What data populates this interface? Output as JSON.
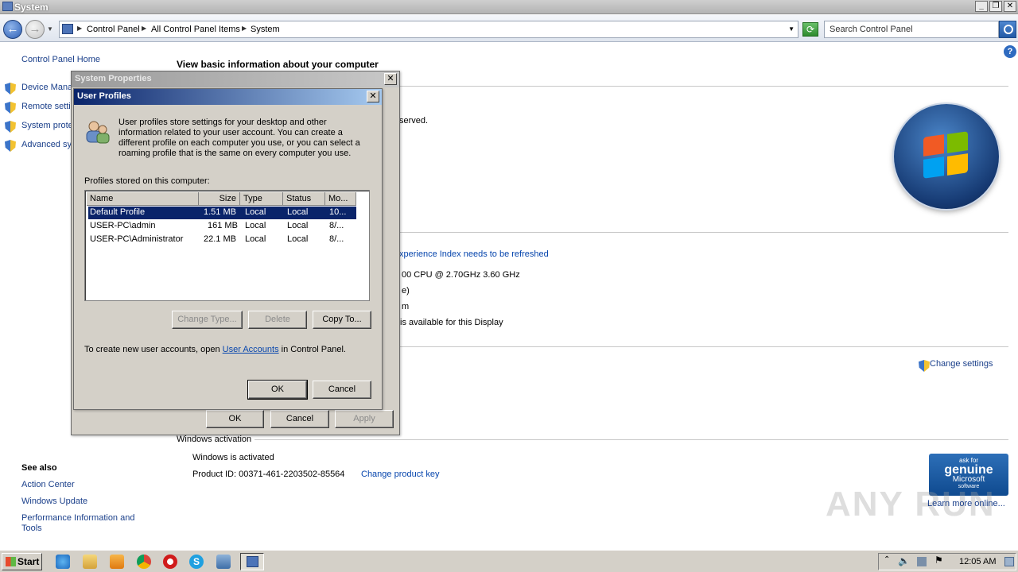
{
  "window": {
    "title": "System"
  },
  "address": {
    "crumbs": [
      "Control Panel",
      "All Control Panel Items",
      "System"
    ],
    "search_placeholder": "Search Control Panel"
  },
  "left_pane": {
    "home": "Control Panel Home",
    "tasks": [
      "Device Mana",
      "Remote setti",
      "System prote",
      "Advanced sy"
    ],
    "see_also_heading": "See also",
    "see_also": [
      "Action Center",
      "Windows Update",
      "Performance Information and",
      "Tools"
    ]
  },
  "main": {
    "heading": "View basic information about your computer",
    "copyright_fragment": "served.",
    "rating_link": "xperience Index needs to be refreshed",
    "processor": "00 CPU @ 2.70GHz   3.60 GHz",
    "ram_fragment": "e)",
    "systype_fragment": "m",
    "pen_fragment": "is available for this Display",
    "change_settings": "Change settings",
    "activation_heading": "Windows activation",
    "activation_status": "Windows is activated",
    "product_id": "Product ID:  00371-461-2203502-85564",
    "change_key": "Change product key",
    "genuine": {
      "line1": "ask for",
      "line2": "genuine",
      "line3": "Microsoft",
      "line4": "software"
    },
    "learn_more": "Learn more online...",
    "watermark": "ANY RUN"
  },
  "system_properties": {
    "title": "System Properties",
    "close": "✕",
    "ok": "OK",
    "cancel": "Cancel",
    "apply": "Apply"
  },
  "user_profiles": {
    "title": "User Profiles",
    "close": "✕",
    "description": [
      "User profiles store settings for your desktop and other",
      "information related to your user account. You can create a",
      "different profile on each computer you use, or you can select a",
      "roaming profile that is the same on every computer you use."
    ],
    "list_label": "Profiles stored on this computer:",
    "columns": [
      "Name",
      "Size",
      "Type",
      "Status",
      "Mo..."
    ],
    "rows": [
      [
        "Default Profile",
        "1.51 MB",
        "Local",
        "Local",
        "10..."
      ],
      [
        "USER-PC\\admin",
        "161 MB",
        "Local",
        "Local",
        "8/..."
      ],
      [
        "USER-PC\\Administrator",
        "22.1 MB",
        "Local",
        "Local",
        "8/..."
      ]
    ],
    "change_type": "Change Type...",
    "delete": "Delete",
    "copy_to": "Copy To...",
    "footer_pre": "To create new user accounts, open ",
    "footer_link": "User Accounts",
    "footer_post": " in Control Panel.",
    "ok": "OK",
    "cancel": "Cancel"
  },
  "taskbar": {
    "start": "Start",
    "clock": "12:05 AM"
  }
}
